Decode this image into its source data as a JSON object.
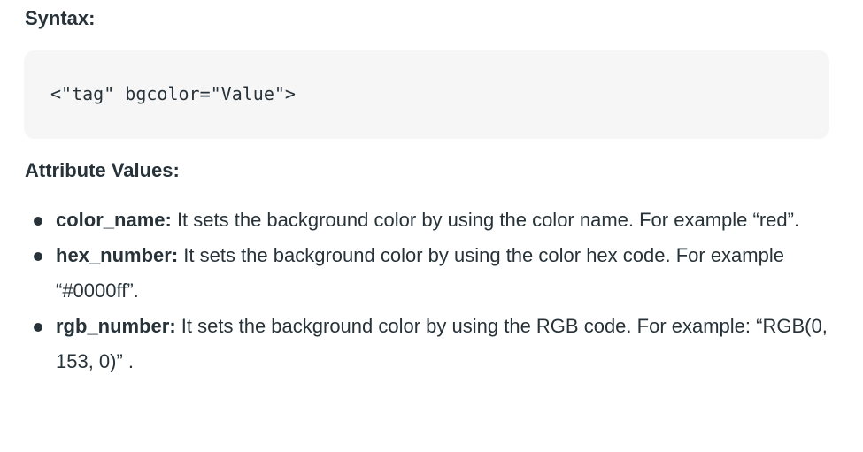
{
  "syntax": {
    "heading": "Syntax:",
    "code": "<\"tag\" bgcolor=\"Value\">"
  },
  "attribute_values": {
    "heading": "Attribute Values:",
    "items": [
      {
        "term": "color_name:",
        "description": " It sets the background color by using the color name. For example “red”."
      },
      {
        "term": "hex_number:",
        "description": " It sets the background color by using the color hex code. For example “#0000ff”."
      },
      {
        "term": "rgb_number:",
        "description": " It sets the background color by using the RGB code. For example: “RGB(0, 153, 0)” ."
      }
    ]
  }
}
